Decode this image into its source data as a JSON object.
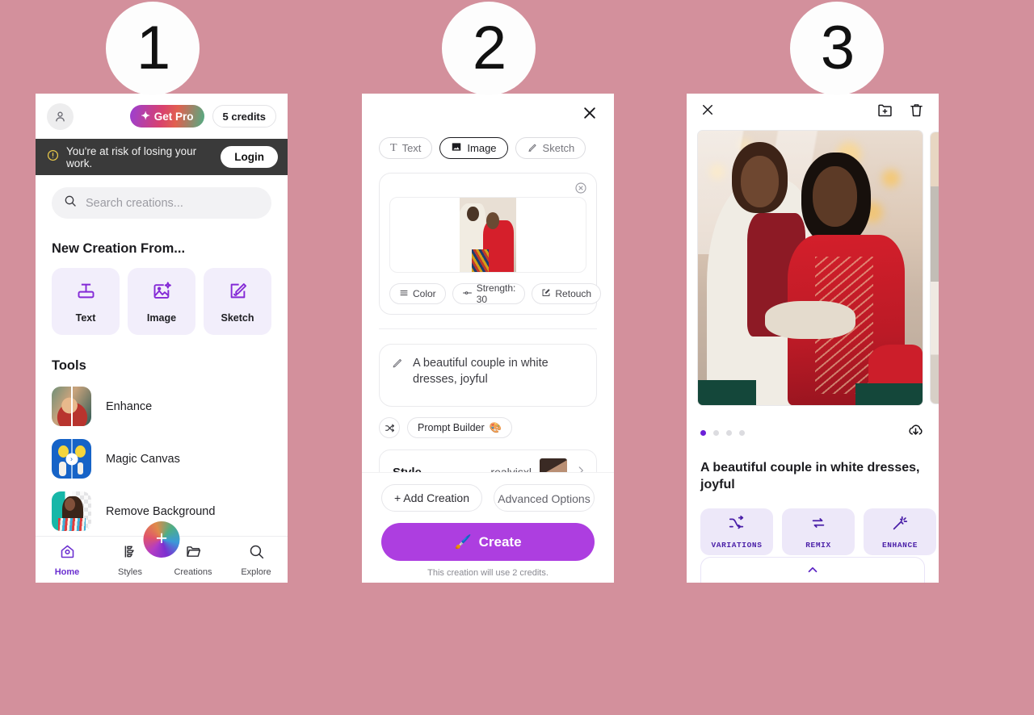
{
  "page": {
    "background_color": "#d3909c",
    "steps": [
      {
        "number": "1"
      },
      {
        "number": "2"
      },
      {
        "number": "3"
      }
    ]
  },
  "phone1": {
    "topbar": {
      "avatar_icon": "user-avatar-icon",
      "get_pro_label": "Get Pro",
      "get_pro_icon": "sparkle-icon",
      "credits_label": "5 credits"
    },
    "warning": {
      "icon": "alert-circle-icon",
      "text": "You're at risk of losing your work.",
      "login_label": "Login"
    },
    "search": {
      "icon": "search-icon",
      "placeholder": "Search creations..."
    },
    "new_creation": {
      "title": "New Creation From...",
      "items": [
        {
          "label": "Text",
          "icon": "text-box-icon"
        },
        {
          "label": "Image",
          "icon": "image-sparkle-icon"
        },
        {
          "label": "Sketch",
          "icon": "sketch-pencil-icon"
        }
      ]
    },
    "tools": {
      "title": "Tools",
      "items": [
        {
          "label": "Enhance",
          "icon": "enhance-thumbnail"
        },
        {
          "label": "Magic Canvas",
          "icon": "magic-canvas-thumbnail"
        },
        {
          "label": "Remove Background",
          "icon": "remove-background-thumbnail"
        }
      ]
    },
    "nav": [
      {
        "label": "Home",
        "icon": "home-camera-icon",
        "active": true
      },
      {
        "label": "Styles",
        "icon": "styles-icon",
        "active": false
      },
      {
        "label": "Creations",
        "icon": "folder-icon",
        "active": false
      },
      {
        "label": "Explore",
        "icon": "search-icon",
        "active": false
      }
    ],
    "nav_fab_icon": "plus-icon"
  },
  "phone2": {
    "close_icon": "close-icon",
    "modes": [
      {
        "label": "Text",
        "icon": "text-icon",
        "selected": false
      },
      {
        "label": "Image",
        "icon": "image-icon",
        "selected": true
      },
      {
        "label": "Sketch",
        "icon": "sketch-icon",
        "selected": false
      }
    ],
    "image_card": {
      "clear_icon": "clear-circle-icon",
      "thumbnail": "reference-photo"
    },
    "options": [
      {
        "label": "Color",
        "icon": "sliders-icon"
      },
      {
        "label": "Strength: 30",
        "icon": "strength-slider-icon"
      },
      {
        "label": "Retouch",
        "icon": "retouch-pencil-icon"
      }
    ],
    "prompt": {
      "icon": "pencil-icon",
      "text": "A beautiful couple in white dresses, joyful"
    },
    "prompt_builder": {
      "shuffle_icon": "shuffle-icon",
      "label": "Prompt Builder",
      "emoji": "🎨"
    },
    "style": {
      "label": "Style",
      "value": "realvisxl",
      "thumbnail": "style-preview",
      "chevron_icon": "chevron-right-icon"
    },
    "footer": {
      "add_creation_label": "+ Add Creation",
      "advanced_options_label": "Advanced Options",
      "create_label": "Create",
      "create_icon": "paintbrush-icon",
      "credits_note": "This creation will use 2 credits."
    }
  },
  "phone3": {
    "header": {
      "close_icon": "close-icon",
      "add_to_folder_icon": "folder-plus-icon",
      "delete_icon": "trash-icon"
    },
    "hero_image": "generated-couple-photo",
    "carousel": {
      "total_dots": 4,
      "active_index": 0,
      "download_icon": "cloud-download-icon"
    },
    "caption": "A beautiful couple in white dresses, joyful",
    "actions": [
      {
        "label": "VARIATIONS",
        "icon": "variations-icon"
      },
      {
        "label": "REMIX",
        "icon": "remix-icon"
      },
      {
        "label": "ENHANCE",
        "icon": "enhance-wand-icon"
      },
      {
        "label": "",
        "icon": "partial-action-icon"
      }
    ]
  },
  "colors": {
    "background": "#d3909c",
    "accent_purple": "#6b1fd8",
    "create_button": "#ad3ee0",
    "warning_bar": "#3a3a3a",
    "card_lavender": "#f2eefb"
  }
}
